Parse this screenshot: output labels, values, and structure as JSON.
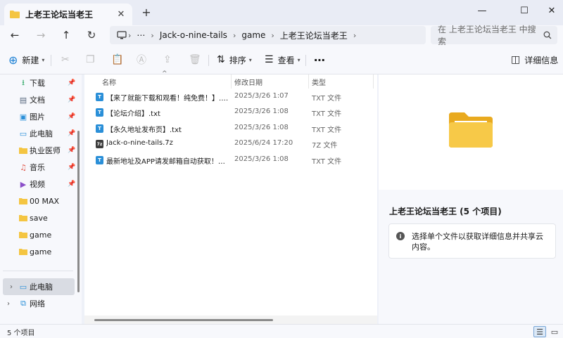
{
  "tab": {
    "title": "上老王论坛当老王",
    "close": "✕",
    "new_tab": "+"
  },
  "window": {
    "minimize": "—",
    "maximize": "☐",
    "close": "✕"
  },
  "nav": {
    "back": "←",
    "forward": "→",
    "up": "↑",
    "refresh": "↻",
    "breadcrumb": [
      "Jack-o-nine-tails",
      "game",
      "上老王论坛当老王"
    ],
    "more": "⋯",
    "search_placeholder": "在 上老王论坛当老王 中搜索"
  },
  "commands": {
    "new": "新建",
    "sort": "排序",
    "view": "查看",
    "more": "⋯",
    "details": "详细信息"
  },
  "sidebar": {
    "items": [
      {
        "label": "下载",
        "icon": "download-icon",
        "pinned": true
      },
      {
        "label": "文档",
        "icon": "document-icon",
        "pinned": true
      },
      {
        "label": "图片",
        "icon": "pictures-icon",
        "pinned": true
      },
      {
        "label": "此电脑",
        "icon": "pc-icon",
        "pinned": true
      },
      {
        "label": "执业医师",
        "icon": "folder-icon",
        "pinned": true
      },
      {
        "label": "音乐",
        "icon": "music-icon",
        "pinned": true
      },
      {
        "label": "视频",
        "icon": "video-icon",
        "pinned": true
      },
      {
        "label": "00 MAX",
        "icon": "folder-icon",
        "pinned": false
      },
      {
        "label": "save",
        "icon": "folder-icon",
        "pinned": false
      },
      {
        "label": "game",
        "icon": "folder-icon",
        "pinned": false
      },
      {
        "label": "game",
        "icon": "folder-icon",
        "pinned": false
      }
    ],
    "tree": [
      {
        "label": "此电脑",
        "icon": "pc-icon",
        "selected": true
      },
      {
        "label": "网络",
        "icon": "network-icon",
        "selected": false
      }
    ]
  },
  "columns": {
    "name": "名称",
    "date": "修改日期",
    "type": "类型"
  },
  "files": [
    {
      "name": "【来了就能下载和观看！纯免费！】.txt",
      "date": "2025/3/26 1:07",
      "type": "TXT 文件",
      "kind": "txt"
    },
    {
      "name": "【论坛介绍】.txt",
      "date": "2025/3/26 1:08",
      "type": "TXT 文件",
      "kind": "txt"
    },
    {
      "name": "【永久地址发布页】.txt",
      "date": "2025/3/26 1:08",
      "type": "TXT 文件",
      "kind": "txt"
    },
    {
      "name": "Jack-o-nine-tails.7z",
      "date": "2025/6/24 17:20",
      "type": "7Z 文件",
      "kind": "7z"
    },
    {
      "name": "最新地址及APP请发邮箱自动获取！！！...",
      "date": "2025/3/26 1:08",
      "type": "TXT 文件",
      "kind": "txt"
    }
  ],
  "details": {
    "title": "上老王论坛当老王 (5 个项目)",
    "info": "选择单个文件以获取详细信息并共享云内容。"
  },
  "status": {
    "count": "5 个项目"
  },
  "colors": {
    "accent": "#1a7fd4",
    "folder": "#f4c542",
    "txt_icon": "#2a8fd8"
  }
}
